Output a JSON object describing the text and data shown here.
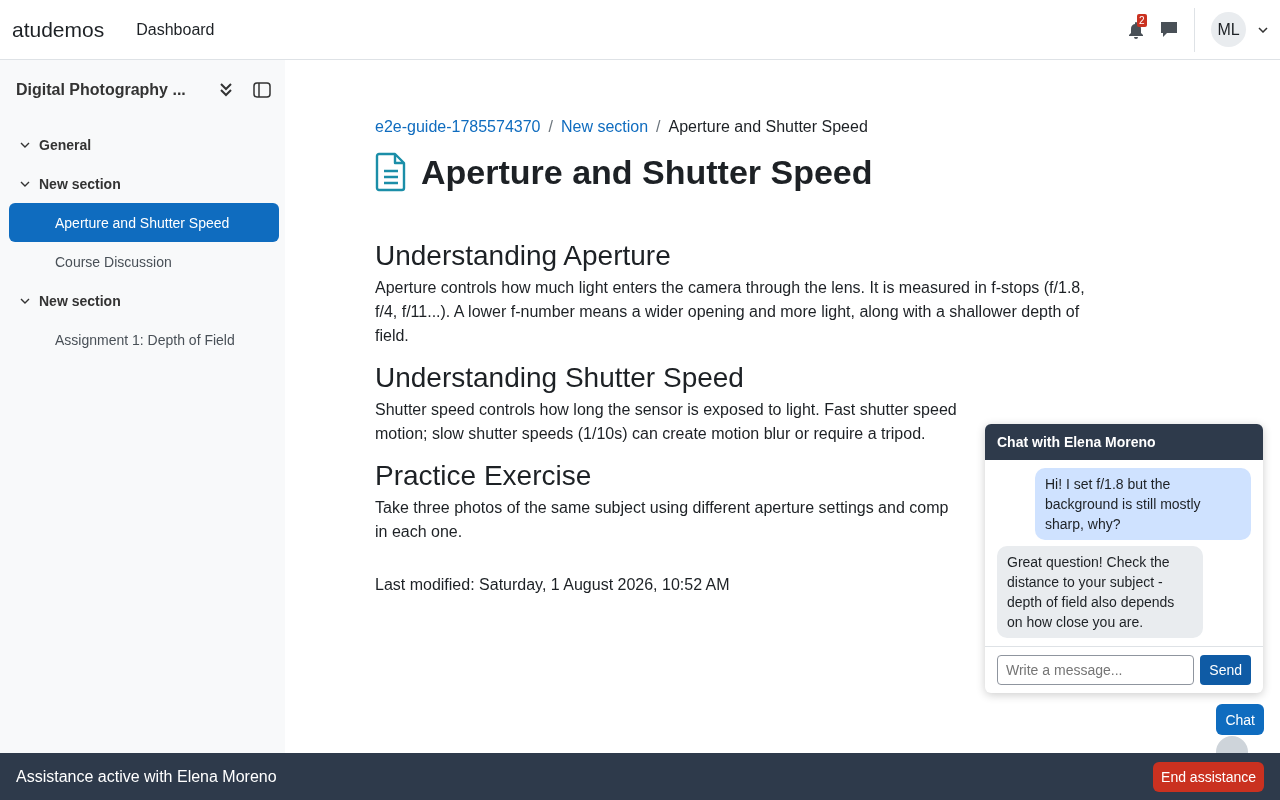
{
  "navbar": {
    "brand": "atudemos",
    "links": [
      {
        "label": "Dashboard"
      }
    ],
    "notification_count": "2",
    "avatar": "ML"
  },
  "sidebar": {
    "title": "Digital Photography ...",
    "sections": [
      {
        "title": "General",
        "expanded": true
      },
      {
        "title": "New section",
        "expanded": true,
        "children": [
          {
            "label": "Aperture and Shutter Speed",
            "selected": true
          },
          {
            "label": "Course Discussion",
            "selected": false
          }
        ]
      },
      {
        "title": "New section",
        "expanded": true,
        "children": [
          {
            "label": "Assignment 1: Depth of Field",
            "selected": false
          }
        ]
      }
    ]
  },
  "breadcrumb_separator": "/",
  "breadcrumb": [
    {
      "label": "e2e-guide-1785574370",
      "link": true
    },
    {
      "label": "New section",
      "link": true
    },
    {
      "label": "Aperture and Shutter Speed",
      "link": false
    }
  ],
  "page_title": "Aperture and Shutter Speed",
  "sections": [
    {
      "heading": "Understanding Aperture",
      "lines": [
        "Aperture controls how much light enters the camera through the lens. It is measured in f-stops (f/1.8,",
        "f/4, f/11...). A lower f-number means a wider opening and more light, along with a shallower depth of",
        "field."
      ]
    },
    {
      "heading": "Understanding Shutter Speed",
      "lines": [
        "Shutter speed controls how long the sensor is exposed to light. Fast shutter speed",
        "motion; slow shutter speeds (1/10s) can create motion blur or require a tripod."
      ]
    },
    {
      "heading": "Practice Exercise",
      "lines": [
        "Take three photos of the same subject using different aperture settings and comp",
        "in each one."
      ]
    }
  ],
  "last_modified": "Last modified: Saturday, 1 August 2026, 10:52 AM",
  "chat": {
    "title": "Chat with Elena Moreno",
    "messages": [
      {
        "kind": "sent",
        "text": "Hi! I set f/1.8 but the background is still mostly sharp, why?"
      },
      {
        "kind": "received",
        "text": "Great question! Check the distance to your subject - depth of field also depends on how close you are."
      }
    ],
    "placeholder": "Write a message...",
    "send": "Send",
    "toggle": "Chat"
  },
  "footer": {
    "text": "Assistance active with Elena Moreno",
    "button": "End assistance"
  }
}
